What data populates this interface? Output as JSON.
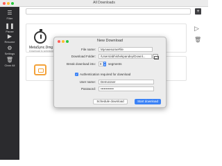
{
  "window": {
    "title": "All Downloads"
  },
  "sidebar": {
    "items": [
      {
        "label": "Filter",
        "icon": "filter-icon"
      },
      {
        "label": "Pause",
        "icon": "pause-icon"
      },
      {
        "label": "Resume",
        "icon": "play-icon"
      },
      {
        "label": "Settings",
        "icon": "gear-icon"
      },
      {
        "label": "Clear All",
        "icon": "trash-icon"
      }
    ]
  },
  "search": {
    "placeholder": ""
  },
  "toolbar": {
    "add_label": "+"
  },
  "downloads": [
    {
      "name": "MetaSync.Dmg",
      "status": "Download is scheduled to run with scheduler"
    }
  ],
  "dialog": {
    "title": "New Download",
    "file_name_label": "File name:",
    "file_name_value": "MyAwesomeFile",
    "folder_label": "Download Folder:",
    "folder_value": "/Users/abhishekpandey/Downl...",
    "segments_label": "Break download into:",
    "segments_value": "8",
    "segments_unit": "segments",
    "auth_label": "Authentication required for download",
    "auth_checked": true,
    "username_label": "User name:",
    "username_value": "DemoUser",
    "password_label": "Password:",
    "password_value": "••••••••••••",
    "schedule_button": "Schedule download",
    "start_button": "Start download"
  },
  "colors": {
    "accent": "#3b82f6",
    "sidebar": "#2b2b2e",
    "file_icon": "#f3a23a"
  }
}
